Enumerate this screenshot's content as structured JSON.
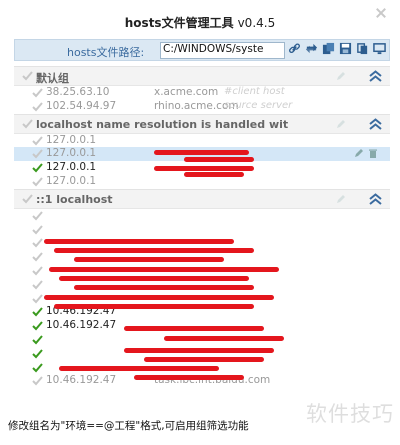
{
  "app": {
    "title": "hosts文件管理工具",
    "version": "v0.4.5"
  },
  "pathbar": {
    "label": "hosts文件路径:",
    "value": "C:/WINDOWS/syste"
  },
  "toolbar": {
    "icons": [
      "link-icon",
      "refresh-icon",
      "import-icon",
      "save-icon",
      "copy-icon",
      "monitor-icon"
    ]
  },
  "groups": [
    {
      "name": "默认组",
      "rows": [
        {
          "ip": "38.25.63.10",
          "host": "x.acme.com",
          "comment": "#client host",
          "enabled": false
        },
        {
          "ip": "102.54.94.97",
          "host": "rhino.acme.com",
          "comment": "source server",
          "enabled": false
        }
      ]
    },
    {
      "name": "localhost name resolution is handled wit",
      "rows": [
        {
          "ip": "127.0.0.1",
          "enabled": false
        },
        {
          "ip": "127.0.0.1",
          "enabled": false,
          "selected": true
        },
        {
          "ip": "127.0.0.1",
          "enabled": true
        },
        {
          "ip": "127.0.0.1",
          "enabled": false
        }
      ]
    },
    {
      "name": "::1 localhost",
      "rows": [
        {
          "ip": "",
          "host": "",
          "enabled": false
        },
        {
          "ip": "",
          "host": "",
          "enabled": false
        },
        {
          "ip": "",
          "host": "",
          "enabled": false
        },
        {
          "ip": "",
          "host": "",
          "enabled": false
        },
        {
          "ip": "",
          "host": "",
          "enabled": false
        },
        {
          "ip": "",
          "host": "",
          "enabled": false
        },
        {
          "ip": "",
          "host": "",
          "enabled": false
        },
        {
          "ip": "10.46.192.47",
          "host": "",
          "enabled": true
        },
        {
          "ip": "10.46.192.47",
          "host": "",
          "enabled": true
        },
        {
          "ip": "",
          "host": "",
          "enabled": true
        },
        {
          "ip": "",
          "host": "",
          "enabled": true
        },
        {
          "ip": "",
          "host": "",
          "enabled": true
        },
        {
          "ip": "10.46.192.47",
          "host": "task.lbc.int.baidu.com",
          "enabled": false
        }
      ]
    }
  ],
  "status": {
    "text": "修改组名为\"环境==@工程\"格式,可启用组筛选功能"
  },
  "watermark": {
    "text": "软件技巧"
  },
  "colors": {
    "accent": "#3b6b9f",
    "redaction": "#e4161d",
    "check_on": "#3a9a1e",
    "check_off": "#c8c8c8"
  }
}
